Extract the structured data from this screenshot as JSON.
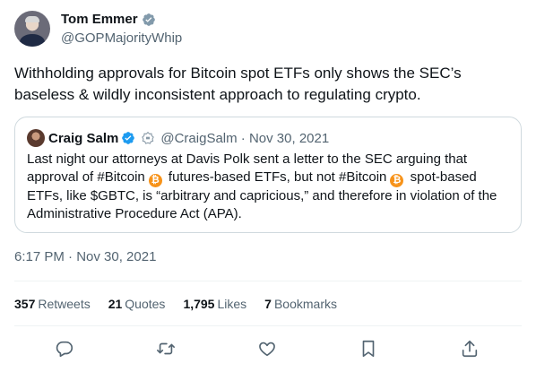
{
  "author": {
    "name": "Tom Emmer",
    "handle": "@GOPMajorityWhip"
  },
  "tweet": {
    "text": "Withholding approvals for Bitcoin spot ETFs only shows the SEC’s baseless & wildly inconsistent approach to regulating crypto.",
    "timestamp": "6:17 PM · Nov 30, 2021"
  },
  "quote": {
    "name": "Craig Salm",
    "handle_date": "@CraigSalm · Nov 30, 2021",
    "text_part1": "Last night our attorneys at Davis Polk sent a letter to the SEC arguing that approval of #Bitcoin",
    "text_part2": "futures-based ETFs, but not #Bitcoin",
    "text_part3": "spot-based ETFs, like $GBTC, is “arbitrary and capricious,” and therefore in violation of the Administrative Procedure Act (APA).",
    "bitcoin_emoji": "₿"
  },
  "stats": {
    "retweets_count": "357",
    "retweets_label": "Retweets",
    "quotes_count": "21",
    "quotes_label": "Quotes",
    "likes_count": "1,795",
    "likes_label": "Likes",
    "bookmarks_count": "7",
    "bookmarks_label": "Bookmarks"
  },
  "actions": [
    "reply-icon",
    "retweet-icon",
    "like-icon",
    "bookmark-icon",
    "share-icon"
  ],
  "colors": {
    "verified": "#1d9bf0",
    "secondary_text": "#536471",
    "icon": "#536471",
    "bitcoin": "#f7931a"
  }
}
